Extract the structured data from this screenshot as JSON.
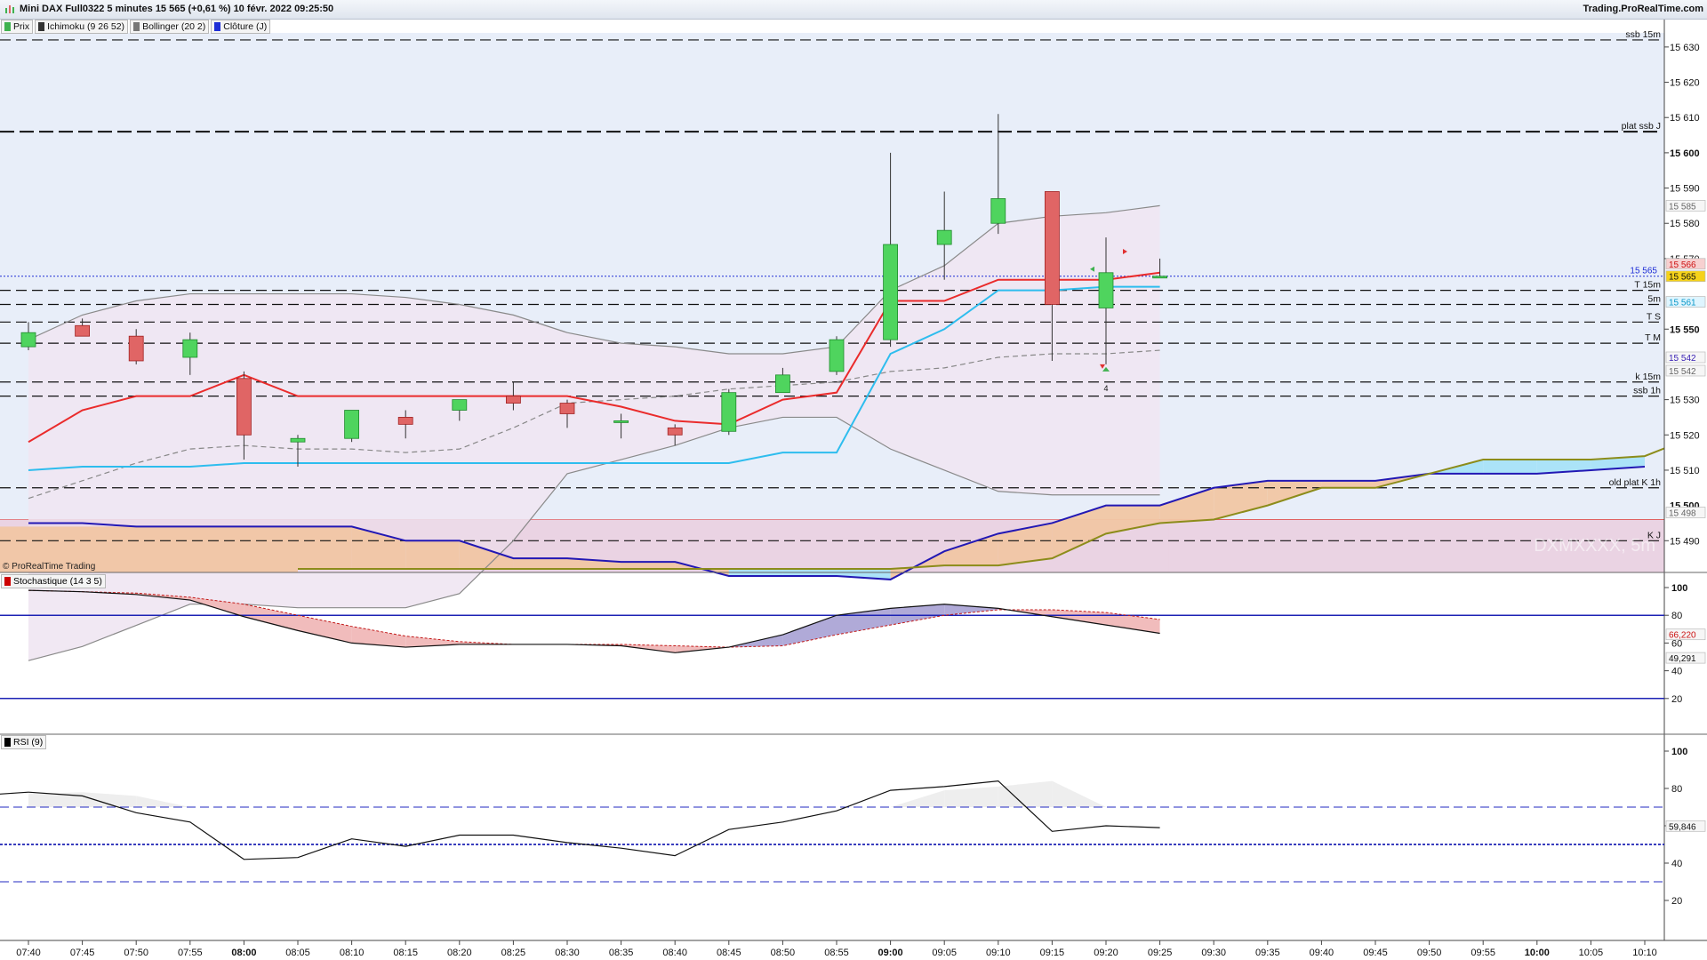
{
  "window": {
    "title": "Mini DAX Full0322 5 minutes 15 565 (+0,61 %) 10 févr. 2022 09:25:50",
    "site": "Trading.ProRealTime.com"
  },
  "legend": [
    {
      "label": "Prix",
      "color": "#3fb24f"
    },
    {
      "label": "Ichimoku (9 26 52)",
      "color": "#333333"
    },
    {
      "label": "Bollinger (20 2)",
      "color": "#777777"
    },
    {
      "label": "Clôture (J)",
      "color": "#1f2fd6"
    }
  ],
  "copyright": "© ProRealTime Trading",
  "watermark": "DXMXXXX, 5m",
  "colors": {
    "bg_top": "#e8eef9",
    "bollinger_fill": "#efe5f2",
    "zone_pink": "#ead3e3",
    "zone_orange": "#f1c6a4",
    "cloud_blue": "#a8e2f8",
    "up": "#4fd45e",
    "down": "#e06565",
    "tenkan": "#ea2b2b",
    "kijun": "#2ebdee",
    "ssa": "#8c8c1a",
    "ssb": "#2218b4",
    "ref_line": "#1f2fd6"
  },
  "chart_data": [
    {
      "type": "candlestick",
      "title": "",
      "price_ylim": [
        15481,
        15634
      ],
      "times": [
        "07:40",
        "07:45",
        "07:50",
        "07:55",
        "08:00",
        "08:05",
        "08:10",
        "08:15",
        "08:20",
        "08:25",
        "08:30",
        "08:35",
        "08:40",
        "08:45",
        "08:50",
        "08:55",
        "09:00",
        "09:05",
        "09:10",
        "09:15",
        "09:20",
        "09:25",
        "09:30",
        "09:35",
        "09:40",
        "09:45",
        "09:50",
        "09:55",
        "10:00",
        "10:05",
        "10:10"
      ],
      "x_ticks": [
        "07:40",
        "07:45",
        "07:50",
        "07:55",
        "08:00",
        "08:05",
        "08:10",
        "08:15",
        "08:20",
        "08:25",
        "08:30",
        "08:35",
        "08:40",
        "08:45",
        "08:50",
        "08:55",
        "09:00",
        "09:05",
        "09:10",
        "09:15",
        "09:20",
        "09:25",
        "09:30",
        "09:35",
        "09:40",
        "09:45",
        "09:50",
        "09:55",
        "10:00",
        "10:05",
        "10:10"
      ],
      "bold_ticks": [
        "08:00",
        "09:00",
        "10:00"
      ],
      "y_ticks": [
        "15 630",
        "15 620",
        "15 610",
        "15 600",
        "15 590",
        "15 580",
        "15 570",
        "15 550",
        "15 530",
        "15 520",
        "15 510",
        "15 490"
      ],
      "bold_y_ticks": [
        "15 600",
        "15 550"
      ],
      "candles": [
        {
          "o": 15545,
          "h": 15552,
          "l": 15544,
          "c": 15549
        },
        {
          "o": 15551,
          "h": 15553,
          "l": 15548,
          "c": 15548
        },
        {
          "o": 15548,
          "h": 15550,
          "l": 15540,
          "c": 15541
        },
        {
          "o": 15542,
          "h": 15549,
          "l": 15537,
          "c": 15547
        },
        {
          "o": 15536,
          "h": 15538,
          "l": 15513,
          "c": 15520
        },
        {
          "o": 15518,
          "h": 15520,
          "l": 15511,
          "c": 15519
        },
        {
          "o": 15519,
          "h": 15527,
          "l": 15518,
          "c": 15527
        },
        {
          "o": 15525,
          "h": 15527,
          "l": 15519,
          "c": 15523
        },
        {
          "o": 15527,
          "h": 15530,
          "l": 15524,
          "c": 15530
        },
        {
          "o": 15531,
          "h": 15535,
          "l": 15527,
          "c": 15529
        },
        {
          "o": 15529,
          "h": 15530,
          "l": 15522,
          "c": 15526
        },
        {
          "o": 15524,
          "h": 15526,
          "l": 15519,
          "c": 15524
        },
        {
          "o": 15522,
          "h": 15523,
          "l": 15517,
          "c": 15520
        },
        {
          "o": 15521,
          "h": 15533,
          "l": 15520,
          "c": 15532
        },
        {
          "o": 15532,
          "h": 15539,
          "l": 15532,
          "c": 15537
        },
        {
          "o": 15538,
          "h": 15548,
          "l": 15537,
          "c": 15547
        },
        {
          "o": 15547,
          "h": 15600,
          "l": 15545,
          "c": 15574
        },
        {
          "o": 15574,
          "h": 15589,
          "l": 15564,
          "c": 15578
        },
        {
          "o": 15580,
          "h": 15611,
          "l": 15577,
          "c": 15587
        },
        {
          "o": 15589,
          "h": 15589,
          "l": 15541,
          "c": 15557
        },
        {
          "o": 15556,
          "h": 15576,
          "l": 15540,
          "c": 15566
        },
        {
          "o": 15565,
          "h": 15570,
          "l": 15565,
          "c": 15565
        }
      ],
      "tenkan": [
        15518,
        15527,
        15531,
        15531,
        15537,
        15531,
        15531,
        15531,
        15531,
        15531,
        15531,
        15528,
        15524,
        15523,
        15530,
        15532,
        15558,
        15558,
        15564,
        15564,
        15564,
        15566
      ],
      "kijun": [
        15510,
        15511,
        15511,
        15511,
        15512,
        15512,
        15512,
        15512,
        15512,
        15512,
        15512,
        15512,
        15512,
        15512,
        15515,
        15515,
        15543,
        15550,
        15561,
        15561,
        15562,
        15562
      ],
      "ssa_start": 5,
      "ssa": [
        15482,
        15482,
        15482,
        15482,
        15482,
        15482,
        15482,
        15482,
        15482,
        15482,
        15482,
        15482,
        15483,
        15483,
        15485,
        15492,
        15495,
        15496,
        15500,
        15505,
        15505,
        15509,
        15513,
        15513,
        15513,
        15514,
        15520,
        15523,
        15523,
        15527,
        15524
      ],
      "ssb_start": 0,
      "ssb": [
        15495,
        15495,
        15494,
        15494,
        15494,
        15494,
        15494,
        15490,
        15490,
        15485,
        15485,
        15484,
        15484,
        15480,
        15480,
        15480,
        15479,
        15487,
        15492,
        15495,
        15500,
        15500,
        15505,
        15507,
        15507,
        15507,
        15509,
        15509,
        15509,
        15510,
        15511
      ],
      "boll_upper": [
        15547,
        15554,
        15558,
        15560,
        15560,
        15560,
        15560,
        15559,
        15557,
        15554,
        15549,
        15546,
        15545,
        15543,
        15543,
        15545,
        15561,
        15568,
        15580,
        15582,
        15583,
        15585
      ],
      "boll_lower": [
        15456,
        15460,
        15466,
        15472,
        15472,
        15471,
        15471,
        15471,
        15475,
        15490,
        15509,
        15513,
        15517,
        15522,
        15525,
        15525,
        15516,
        15510,
        15504,
        15503,
        15503,
        15503
      ],
      "boll_mid": [
        15502,
        15507,
        15512,
        15516,
        15517,
        15516,
        15516,
        15515,
        15516,
        15522,
        15529,
        15530,
        15531,
        15533,
        15534,
        15535,
        15538,
        15539,
        15542,
        15543,
        15543,
        15544
      ],
      "hlines": [
        {
          "label": "ssb 15m",
          "value": 15632
        },
        {
          "label": "plat ssb J",
          "value": 15606,
          "thick": true
        },
        {
          "label": "T 15m",
          "value": 15561
        },
        {
          "label": "5m",
          "value": 15557
        },
        {
          "label": "T S",
          "value": 15552
        },
        {
          "label": "T M",
          "value": 15546
        },
        {
          "label": "k 15m",
          "value": 15535
        },
        {
          "label": "ssb 1h",
          "value": 15531
        },
        {
          "label": "old plat K 1h",
          "value": 15505
        },
        {
          "label": "K J",
          "value": 15490
        }
      ],
      "ref_line": {
        "label": "15 565",
        "value": 15565
      },
      "price_badges": [
        {
          "text": "15 566",
          "value": 15566,
          "bg": "#f7d0d0",
          "color": "#c11"
        },
        {
          "text": "15 565",
          "value": 15565,
          "bg": "#f5d21a",
          "color": "#111"
        },
        {
          "text": "15 561",
          "value": 15561,
          "bg": "#dff5ff",
          "color": "#0a98c8"
        },
        {
          "text": "15 585",
          "value": 15585,
          "bg": "#f6f6f6",
          "color": "#666"
        },
        {
          "text": "15 542",
          "value": 15542,
          "bg": "#f6f6f6",
          "color": "#3a22b4"
        },
        {
          "text": "15 542",
          "value": 15542,
          "bg": "#f6f6f6",
          "color": "#666",
          "offset": true
        },
        {
          "text": "15 498",
          "value": 15498,
          "bg": "#f6f6f6",
          "color": "#666"
        }
      ],
      "partial_tick": "15 500",
      "markers": [
        {
          "text": "4",
          "index": 20
        }
      ]
    },
    {
      "type": "line",
      "title": "Stochastique (14 3 5)",
      "ylim": [
        0,
        100
      ],
      "y_ticks": [
        "100",
        "80",
        "60",
        "40",
        "20"
      ],
      "levels": [
        80,
        20
      ],
      "k": [
        98,
        97,
        95,
        91,
        79,
        69,
        60,
        57,
        59,
        59,
        59,
        58,
        53,
        57,
        66,
        80,
        85,
        88,
        85,
        79,
        73,
        67
      ],
      "d": [
        98,
        97,
        96,
        93,
        88,
        80,
        72,
        65,
        61,
        59,
        59,
        59,
        58,
        57,
        58,
        66,
        73,
        80,
        84,
        84,
        82,
        77
      ],
      "badges": [
        {
          "text": "66,220",
          "value": 66.22,
          "color": "#c11"
        },
        {
          "text": "49,291",
          "value": 49.29,
          "color": "#111"
        }
      ]
    },
    {
      "type": "line",
      "title": "RSI (9)",
      "ylim": [
        0,
        100
      ],
      "y_ticks": [
        "100",
        "80",
        "60",
        "40",
        "20"
      ],
      "levels": [
        70,
        50,
        30
      ],
      "rsi": [
        77,
        78,
        76,
        67,
        62,
        42,
        43,
        53,
        49,
        55,
        55,
        51,
        48,
        44,
        58,
        62,
        68,
        79,
        81,
        84,
        57,
        60,
        59
      ],
      "badge": {
        "text": "59,846",
        "value": 59.846
      }
    }
  ]
}
